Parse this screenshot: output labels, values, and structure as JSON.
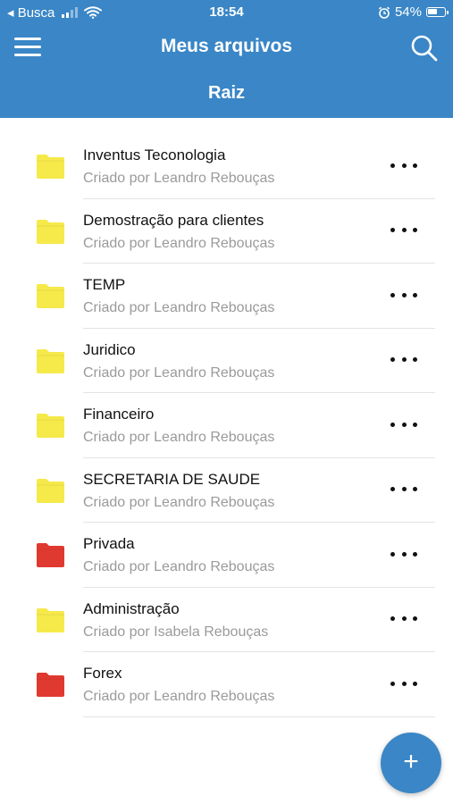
{
  "status_bar": {
    "carrier": "◂ Busca",
    "time": "18:54",
    "battery_percent": "54%",
    "battery_level": 0.54
  },
  "header": {
    "title": "Meus arquivos",
    "breadcrumb": "Raiz",
    "background_color": "#3a86c6"
  },
  "files": [
    {
      "name": "Inventus Teconologia",
      "creator": "Criado por Leandro Rebouças",
      "color": "#f6e94a"
    },
    {
      "name": "Demostração para clientes",
      "creator": "Criado por Leandro Rebouças",
      "color": "#f6e94a"
    },
    {
      "name": "TEMP",
      "creator": "Criado por Leandro Rebouças",
      "color": "#f6e94a"
    },
    {
      "name": "Juridico",
      "creator": "Criado por Leandro Rebouças",
      "color": "#f6e94a"
    },
    {
      "name": "Financeiro",
      "creator": "Criado por Leandro Rebouças",
      "color": "#f6e94a"
    },
    {
      "name": "SECRETARIA DE SAUDE",
      "creator": "Criado por Leandro Rebouças",
      "color": "#f6e94a"
    },
    {
      "name": "Privada",
      "creator": "Criado por Leandro Rebouças",
      "color": "#e0392f"
    },
    {
      "name": "Administração",
      "creator": "Criado por Isabela Rebouças",
      "color": "#f6e94a"
    },
    {
      "name": "Forex",
      "creator": "Criado por Leandro Rebouças",
      "color": "#e0392f"
    }
  ],
  "fab": {
    "label": "+"
  }
}
